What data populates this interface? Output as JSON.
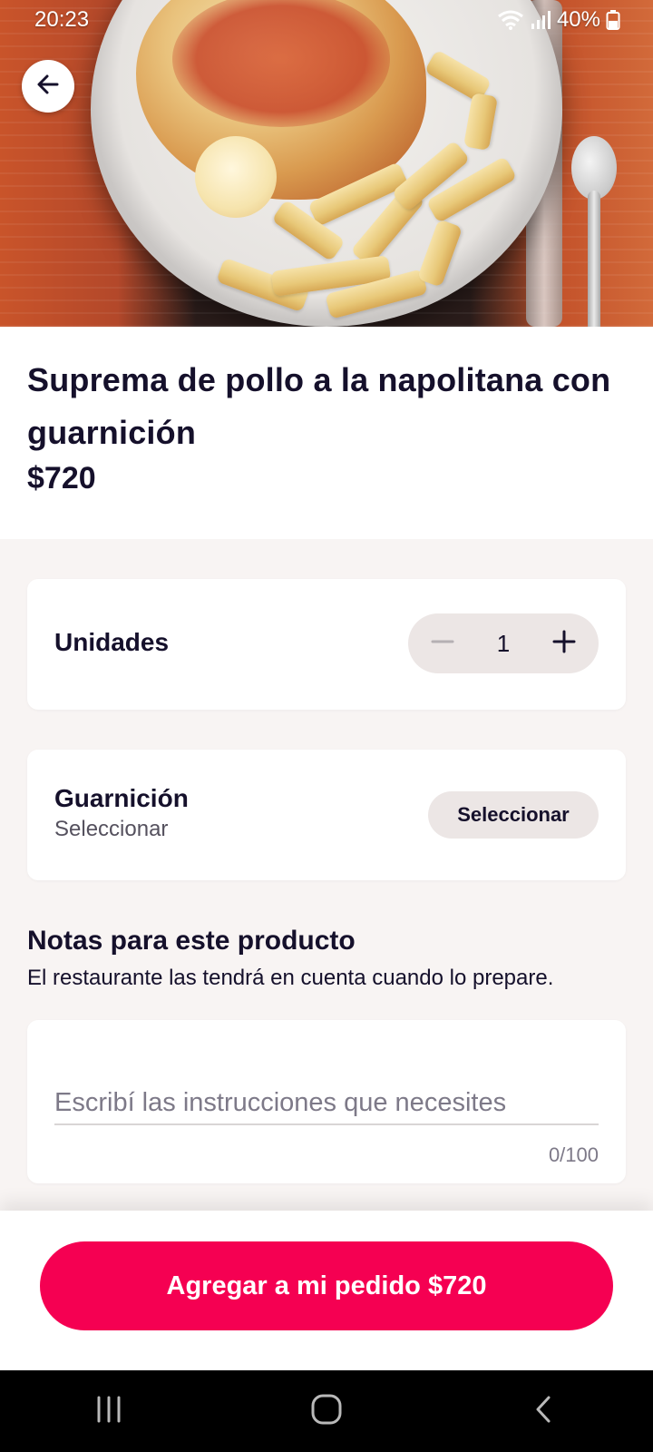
{
  "status_bar": {
    "time": "20:23",
    "battery": "40%",
    "icons": [
      "wifi-icon",
      "signal-icon",
      "battery-icon"
    ]
  },
  "hero": {
    "image": "food-photo",
    "back_icon": "arrow-left-icon"
  },
  "product": {
    "title": "Suprema de pollo a la napolitana con guarnición",
    "price": "$720"
  },
  "units": {
    "label": "Unidades",
    "quantity": "1",
    "minus_icon": "minus-icon",
    "plus_icon": "plus-icon"
  },
  "garnish": {
    "title": "Guarnición",
    "subtitle": "Seleccionar",
    "button_label": "Seleccionar"
  },
  "notes": {
    "title": "Notas para este producto",
    "subtitle": "El restaurante las tendrá en cuenta cuando lo prepare.",
    "placeholder": "Escribí las instrucciones que necesites",
    "counter": "0/100"
  },
  "cta": {
    "label": "Agregar a mi pedido $720"
  },
  "nav_bar": {
    "icons": [
      "recent-apps-icon",
      "home-icon",
      "back-icon"
    ]
  },
  "colors": {
    "accent": "#f50052",
    "text": "#15102b",
    "background": "#f8f4f3",
    "chip": "#ece6e5"
  }
}
